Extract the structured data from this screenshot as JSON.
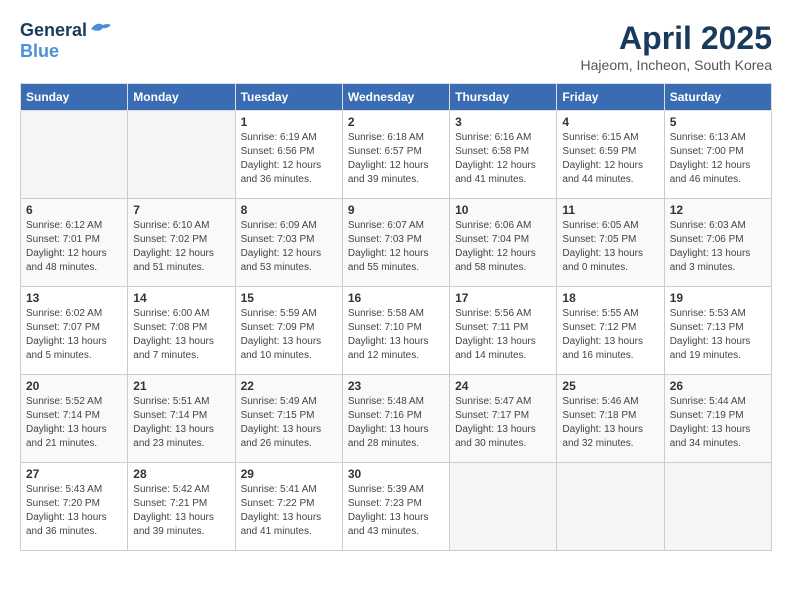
{
  "logo": {
    "general": "General",
    "blue": "Blue"
  },
  "title": "April 2025",
  "subtitle": "Hajeom, Incheon, South Korea",
  "headers": [
    "Sunday",
    "Monday",
    "Tuesday",
    "Wednesday",
    "Thursday",
    "Friday",
    "Saturday"
  ],
  "weeks": [
    [
      {
        "day": "",
        "info": ""
      },
      {
        "day": "",
        "info": ""
      },
      {
        "day": "1",
        "info": "Sunrise: 6:19 AM\nSunset: 6:56 PM\nDaylight: 12 hours\nand 36 minutes."
      },
      {
        "day": "2",
        "info": "Sunrise: 6:18 AM\nSunset: 6:57 PM\nDaylight: 12 hours\nand 39 minutes."
      },
      {
        "day": "3",
        "info": "Sunrise: 6:16 AM\nSunset: 6:58 PM\nDaylight: 12 hours\nand 41 minutes."
      },
      {
        "day": "4",
        "info": "Sunrise: 6:15 AM\nSunset: 6:59 PM\nDaylight: 12 hours\nand 44 minutes."
      },
      {
        "day": "5",
        "info": "Sunrise: 6:13 AM\nSunset: 7:00 PM\nDaylight: 12 hours\nand 46 minutes."
      }
    ],
    [
      {
        "day": "6",
        "info": "Sunrise: 6:12 AM\nSunset: 7:01 PM\nDaylight: 12 hours\nand 48 minutes."
      },
      {
        "day": "7",
        "info": "Sunrise: 6:10 AM\nSunset: 7:02 PM\nDaylight: 12 hours\nand 51 minutes."
      },
      {
        "day": "8",
        "info": "Sunrise: 6:09 AM\nSunset: 7:03 PM\nDaylight: 12 hours\nand 53 minutes."
      },
      {
        "day": "9",
        "info": "Sunrise: 6:07 AM\nSunset: 7:03 PM\nDaylight: 12 hours\nand 55 minutes."
      },
      {
        "day": "10",
        "info": "Sunrise: 6:06 AM\nSunset: 7:04 PM\nDaylight: 12 hours\nand 58 minutes."
      },
      {
        "day": "11",
        "info": "Sunrise: 6:05 AM\nSunset: 7:05 PM\nDaylight: 13 hours\nand 0 minutes."
      },
      {
        "day": "12",
        "info": "Sunrise: 6:03 AM\nSunset: 7:06 PM\nDaylight: 13 hours\nand 3 minutes."
      }
    ],
    [
      {
        "day": "13",
        "info": "Sunrise: 6:02 AM\nSunset: 7:07 PM\nDaylight: 13 hours\nand 5 minutes."
      },
      {
        "day": "14",
        "info": "Sunrise: 6:00 AM\nSunset: 7:08 PM\nDaylight: 13 hours\nand 7 minutes."
      },
      {
        "day": "15",
        "info": "Sunrise: 5:59 AM\nSunset: 7:09 PM\nDaylight: 13 hours\nand 10 minutes."
      },
      {
        "day": "16",
        "info": "Sunrise: 5:58 AM\nSunset: 7:10 PM\nDaylight: 13 hours\nand 12 minutes."
      },
      {
        "day": "17",
        "info": "Sunrise: 5:56 AM\nSunset: 7:11 PM\nDaylight: 13 hours\nand 14 minutes."
      },
      {
        "day": "18",
        "info": "Sunrise: 5:55 AM\nSunset: 7:12 PM\nDaylight: 13 hours\nand 16 minutes."
      },
      {
        "day": "19",
        "info": "Sunrise: 5:53 AM\nSunset: 7:13 PM\nDaylight: 13 hours\nand 19 minutes."
      }
    ],
    [
      {
        "day": "20",
        "info": "Sunrise: 5:52 AM\nSunset: 7:14 PM\nDaylight: 13 hours\nand 21 minutes."
      },
      {
        "day": "21",
        "info": "Sunrise: 5:51 AM\nSunset: 7:14 PM\nDaylight: 13 hours\nand 23 minutes."
      },
      {
        "day": "22",
        "info": "Sunrise: 5:49 AM\nSunset: 7:15 PM\nDaylight: 13 hours\nand 26 minutes."
      },
      {
        "day": "23",
        "info": "Sunrise: 5:48 AM\nSunset: 7:16 PM\nDaylight: 13 hours\nand 28 minutes."
      },
      {
        "day": "24",
        "info": "Sunrise: 5:47 AM\nSunset: 7:17 PM\nDaylight: 13 hours\nand 30 minutes."
      },
      {
        "day": "25",
        "info": "Sunrise: 5:46 AM\nSunset: 7:18 PM\nDaylight: 13 hours\nand 32 minutes."
      },
      {
        "day": "26",
        "info": "Sunrise: 5:44 AM\nSunset: 7:19 PM\nDaylight: 13 hours\nand 34 minutes."
      }
    ],
    [
      {
        "day": "27",
        "info": "Sunrise: 5:43 AM\nSunset: 7:20 PM\nDaylight: 13 hours\nand 36 minutes."
      },
      {
        "day": "28",
        "info": "Sunrise: 5:42 AM\nSunset: 7:21 PM\nDaylight: 13 hours\nand 39 minutes."
      },
      {
        "day": "29",
        "info": "Sunrise: 5:41 AM\nSunset: 7:22 PM\nDaylight: 13 hours\nand 41 minutes."
      },
      {
        "day": "30",
        "info": "Sunrise: 5:39 AM\nSunset: 7:23 PM\nDaylight: 13 hours\nand 43 minutes."
      },
      {
        "day": "",
        "info": ""
      },
      {
        "day": "",
        "info": ""
      },
      {
        "day": "",
        "info": ""
      }
    ]
  ]
}
